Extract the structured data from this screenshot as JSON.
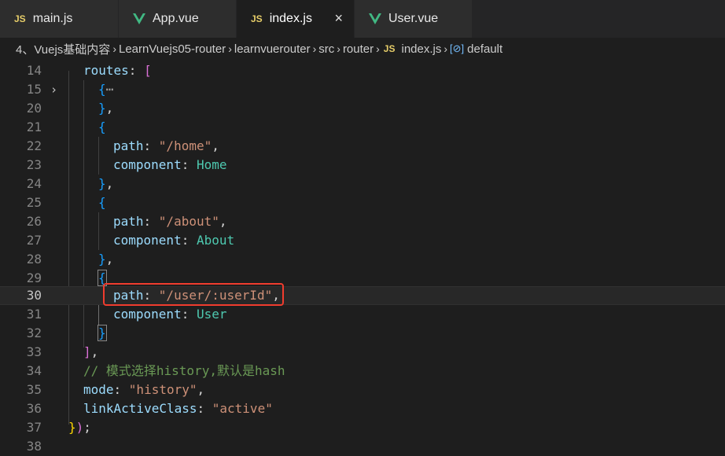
{
  "tabs": [
    {
      "label": "main.js",
      "icon": "js-icon",
      "active": false
    },
    {
      "label": "App.vue",
      "icon": "vue-icon",
      "active": false
    },
    {
      "label": "index.js",
      "icon": "js-icon",
      "active": true
    },
    {
      "label": "User.vue",
      "icon": "vue-icon",
      "active": false
    }
  ],
  "tab_icon_text": "JS",
  "close_glyph": "×",
  "breadcrumb": {
    "items": [
      "4、Vuejs基础内容",
      "LearnVuejs05-router",
      "learnvuerouter",
      "src",
      "router"
    ],
    "file": "index.js",
    "symbol": "default",
    "separator": "›"
  },
  "editor": {
    "fold_glyph": "›",
    "ellipsis": "⋯",
    "lines": [
      {
        "num": "14",
        "parts": {
          "key": "routes",
          "colon": ": ",
          "bracket": "["
        }
      },
      {
        "num": "15",
        "parts": {
          "open": "{",
          "ell": "⋯"
        }
      },
      {
        "num": "20",
        "parts": {
          "close": "}",
          "comma": ","
        }
      },
      {
        "num": "21",
        "parts": {
          "open": "{"
        }
      },
      {
        "num": "22",
        "parts": {
          "key": "path",
          "colon": ": ",
          "str": "\"/home\"",
          "comma": ","
        }
      },
      {
        "num": "23",
        "parts": {
          "key": "component",
          "colon": ": ",
          "type": "Home"
        }
      },
      {
        "num": "24",
        "parts": {
          "close": "}",
          "comma": ","
        }
      },
      {
        "num": "25",
        "parts": {
          "open": "{"
        }
      },
      {
        "num": "26",
        "parts": {
          "key": "path",
          "colon": ": ",
          "str": "\"/about\"",
          "comma": ","
        }
      },
      {
        "num": "27",
        "parts": {
          "key": "component",
          "colon": ": ",
          "type": "About"
        }
      },
      {
        "num": "28",
        "parts": {
          "close": "}",
          "comma": ","
        }
      },
      {
        "num": "29",
        "parts": {
          "open": "{"
        }
      },
      {
        "num": "30",
        "parts": {
          "key": "path",
          "colon": ": ",
          "str": "\"/user/:userId\"",
          "comma": ","
        }
      },
      {
        "num": "31",
        "parts": {
          "key": "component",
          "colon": ": ",
          "type": "User"
        }
      },
      {
        "num": "32",
        "parts": {
          "close": "}"
        }
      },
      {
        "num": "33",
        "parts": {
          "bracket": "]",
          "comma": ","
        }
      },
      {
        "num": "34",
        "parts": {
          "comment": "// 模式选择history,默认是hash"
        }
      },
      {
        "num": "35",
        "parts": {
          "key": "mode",
          "colon": ": ",
          "str": "\"history\"",
          "comma": ","
        }
      },
      {
        "num": "36",
        "parts": {
          "key": "linkActiveClass",
          "colon": ": ",
          "str": "\"active\""
        }
      },
      {
        "num": "37",
        "parts": {
          "close": "}",
          "paren": ")",
          "semi": ";"
        }
      },
      {
        "num": "38",
        "parts": {}
      }
    ]
  },
  "colors": {
    "highlight_box": "#f03c2e",
    "js_icon": "#e6cd69",
    "vue_icon": "#41b883"
  }
}
